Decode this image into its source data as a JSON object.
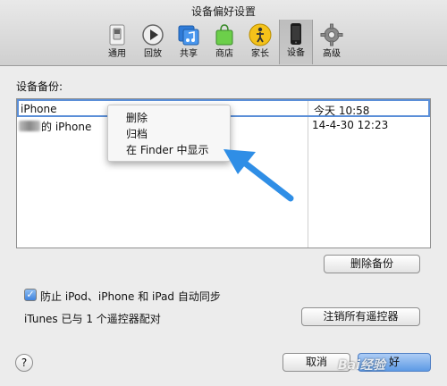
{
  "window": {
    "title": "设备偏好设置"
  },
  "toolbar": {
    "items": [
      {
        "label": "通用",
        "icon": "general-switch-icon"
      },
      {
        "label": "回放",
        "icon": "playback-icon"
      },
      {
        "label": "共享",
        "icon": "sharing-music-icon"
      },
      {
        "label": "商店",
        "icon": "store-bag-icon"
      },
      {
        "label": "家长",
        "icon": "parental-icon"
      },
      {
        "label": "设备",
        "icon": "device-phone-icon",
        "selected": true
      },
      {
        "label": "高级",
        "icon": "advanced-gear-icon"
      }
    ]
  },
  "backups": {
    "label": "设备备份:",
    "rows": [
      {
        "name": "iPhone",
        "date": "今天 10:58"
      },
      {
        "name": "的 iPhone",
        "date": "14-4-30 12:23"
      }
    ],
    "delete_button": "删除备份"
  },
  "context_menu": {
    "items": [
      "删除",
      "归档",
      "在 Finder 中显示"
    ]
  },
  "sync": {
    "checkbox_label": "防止 iPod、iPhone 和 iPad 自动同步",
    "checked": true
  },
  "remotes": {
    "paired_text": "iTunes 已与 1 个遥控器配对",
    "button": "注销所有遥控器"
  },
  "footer": {
    "help": "?",
    "cancel": "取消",
    "ok": "好"
  },
  "watermark": "Bai经验",
  "colors": {
    "selection_border": "#5b8fd8",
    "arrow": "#2f8ee6",
    "ok_button": "#5d9ae5"
  }
}
